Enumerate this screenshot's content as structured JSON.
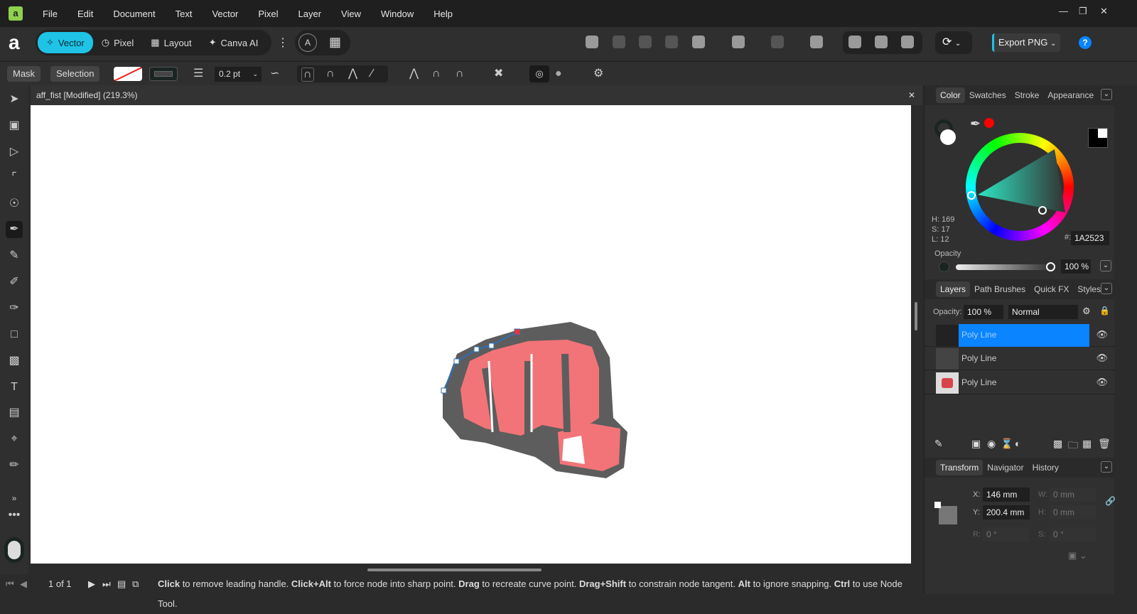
{
  "menu": [
    "File",
    "Edit",
    "Document",
    "Text",
    "Vector",
    "Pixel",
    "Layer",
    "View",
    "Window",
    "Help"
  ],
  "personas": [
    "Vector",
    "Pixel",
    "Layout",
    "Canva AI"
  ],
  "export_label": "Export PNG",
  "context": {
    "mask": "Mask",
    "selection": "Selection",
    "stroke_width": "0.2 pt"
  },
  "document": {
    "title": "aff_fist [Modified] (219.3%)"
  },
  "color_panel": {
    "tabs": [
      "Color",
      "Swatches",
      "Stroke",
      "Appearance"
    ],
    "h": "H: 169",
    "s": "S: 17",
    "l": "L: 12",
    "hex_label": "#:",
    "hex": "1A2523",
    "opacity_label": "Opacity",
    "opacity": "100 %",
    "current_color": "#1A2523"
  },
  "layers_panel": {
    "tabs": [
      "Layers",
      "Path Brushes",
      "Quick FX",
      "Styles"
    ],
    "opacity_label": "Opacity:",
    "opacity": "100 %",
    "blend": "Normal",
    "layers": [
      {
        "name": "Poly Line",
        "selected": true
      },
      {
        "name": "Poly Line",
        "selected": false
      },
      {
        "name": "Poly Line",
        "selected": false
      }
    ]
  },
  "transform_panel": {
    "tabs": [
      "Transform",
      "Navigator",
      "History"
    ],
    "x_label": "X:",
    "x": "146 mm",
    "y_label": "Y:",
    "y": "200.4 mm",
    "w_label": "W:",
    "w": "0 mm",
    "h_label": "H:",
    "h": "0 mm",
    "r_label": "R:",
    "r": "0 °",
    "s_label": "S:",
    "s": "0 °"
  },
  "status": {
    "page": "1 of 1",
    "hint": [
      [
        "Click",
        " to remove leading handle. "
      ],
      [
        "Click+Alt",
        " to force node into sharp point. "
      ],
      [
        "Drag",
        " to recreate curve point. "
      ],
      [
        "Drag+Shift",
        " to constrain node tangent. "
      ],
      [
        "Alt",
        " to ignore snapping. "
      ],
      [
        "Ctrl",
        " to use Node Tool."
      ]
    ]
  }
}
